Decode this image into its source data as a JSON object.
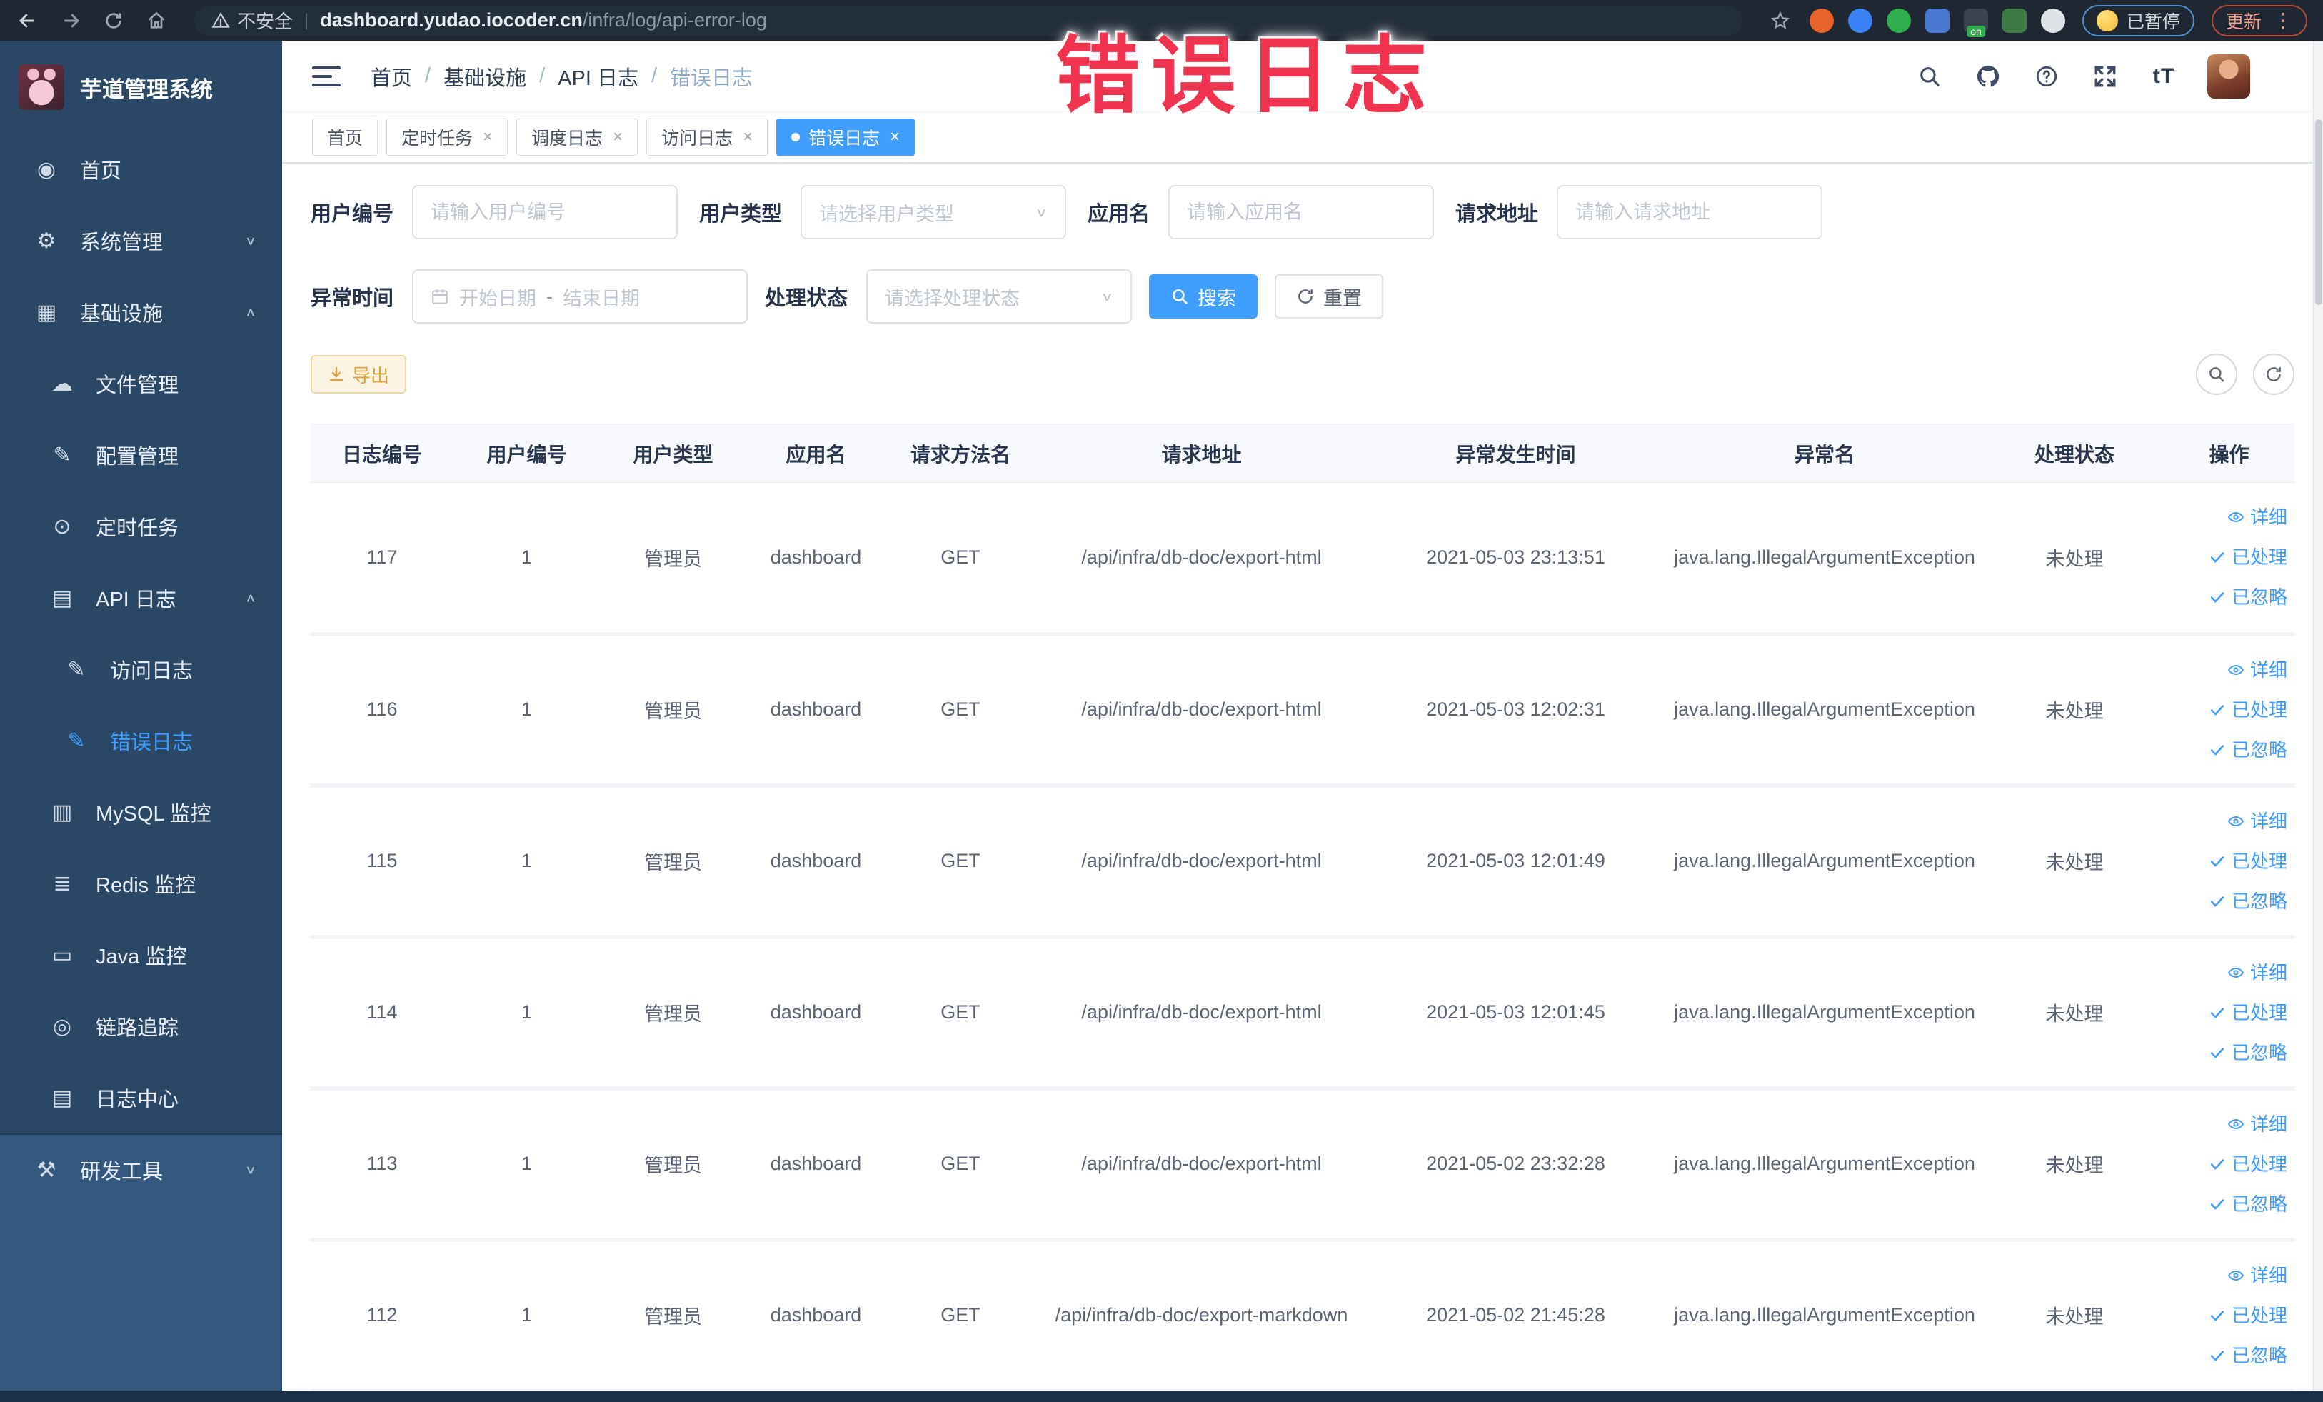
{
  "colors": {
    "accent": "#409eff",
    "sidebar_bg": "#2a4766",
    "sidebar_section_bg": "#35597e",
    "annotation_pink": "#f0344f",
    "export_warning": "#e6a23c",
    "link_blue": "#3d9bff",
    "browser_bar_bg": "#1e2732"
  },
  "annotation": {
    "text": "错误日志"
  },
  "browser": {
    "security_label": "不安全",
    "url_host": "dashboard.yudao.iocoder.cn",
    "url_path": "/infra/log/api-error-log",
    "paused_badge": "已暂停",
    "update_button": "更新",
    "extensions": [
      {
        "name": "orange-ring-extension",
        "color": "#e8622c",
        "shape": "round"
      },
      {
        "name": "blue-pin-extension",
        "color": "#3b82f6",
        "shape": "round"
      },
      {
        "name": "green-check-extension",
        "color": "#2fae4e",
        "shape": "round"
      },
      {
        "name": "blue-grid-extension",
        "color": "#4878d0",
        "shape": "square"
      },
      {
        "name": "switch-on-extension",
        "color": "#3a434e",
        "shape": "square",
        "badge": "on"
      },
      {
        "name": "green-leaf-extension",
        "color": "#3d7a44",
        "shape": "square"
      },
      {
        "name": "white-paw-extension",
        "color": "#dfe3e8",
        "shape": "round"
      }
    ]
  },
  "sidebar": {
    "title": "芋道管理系统",
    "items": [
      {
        "label": "首页",
        "icon": "dashboard",
        "level": 0
      },
      {
        "label": "系统管理",
        "icon": "gear",
        "level": 0,
        "chevron": "down"
      },
      {
        "label": "基础设施",
        "icon": "infrastructure",
        "level": 0,
        "chevron": "up"
      },
      {
        "label": "文件管理",
        "icon": "cloud-upload",
        "level": 1
      },
      {
        "label": "配置管理",
        "icon": "edit",
        "level": 1
      },
      {
        "label": "定时任务",
        "icon": "timer",
        "level": 1
      },
      {
        "label": "API 日志",
        "icon": "log",
        "level": 1,
        "chevron": "up"
      },
      {
        "label": "访问日志",
        "icon": "edit-square",
        "level": 2
      },
      {
        "label": "错误日志",
        "icon": "edit-square",
        "level": 2,
        "active": true
      },
      {
        "label": "MySQL 监控",
        "icon": "mysql",
        "level": 1
      },
      {
        "label": "Redis 监控",
        "icon": "redis",
        "level": 1
      },
      {
        "label": "Java 监控",
        "icon": "java",
        "level": 1
      },
      {
        "label": "链路追踪",
        "icon": "trace",
        "level": 1
      },
      {
        "label": "日志中心",
        "icon": "log-center",
        "level": 1
      },
      {
        "label": "研发工具",
        "icon": "tools",
        "level": 0,
        "chevron": "down",
        "section": true
      }
    ]
  },
  "breadcrumb": {
    "items": [
      {
        "label": "首页"
      },
      {
        "label": "基础设施"
      },
      {
        "label": "API 日志"
      },
      {
        "label": "错误日志",
        "current": true
      }
    ]
  },
  "tabs": {
    "items": [
      {
        "label": "首页"
      },
      {
        "label": "定时任务",
        "closable": true
      },
      {
        "label": "调度日志",
        "closable": true
      },
      {
        "label": "访问日志",
        "closable": true
      },
      {
        "label": "错误日志",
        "closable": true,
        "active": true
      }
    ]
  },
  "filters": {
    "user_id": {
      "label": "用户编号",
      "placeholder": "请输入用户编号"
    },
    "user_type": {
      "label": "用户类型",
      "placeholder": "请选择用户类型"
    },
    "app_name": {
      "label": "应用名",
      "placeholder": "请输入应用名"
    },
    "request_url": {
      "label": "请求地址",
      "placeholder": "请输入请求地址"
    },
    "exception_time": {
      "label": "异常时间",
      "start_placeholder": "开始日期",
      "separator": "-",
      "end_placeholder": "结束日期"
    },
    "process_status": {
      "label": "处理状态",
      "placeholder": "请选择处理状态"
    },
    "search_label": "搜索",
    "reset_label": "重置"
  },
  "toolbar": {
    "export_label": "导出"
  },
  "table": {
    "columns": [
      "日志编号",
      "用户编号",
      "用户类型",
      "应用名",
      "请求方法名",
      "请求地址",
      "异常发生时间",
      "异常名",
      "处理状态",
      "操作"
    ],
    "action_labels": [
      "详细",
      "已处理",
      "已忽略"
    ],
    "rows": [
      {
        "cells": [
          "117",
          "1",
          "管理员",
          "dashboard",
          "GET",
          "/api/infra/db-doc/export-html",
          "2021-05-03 23:13:51",
          "java.lang.IllegalArgumentException",
          "未处理"
        ]
      },
      {
        "cells": [
          "116",
          "1",
          "管理员",
          "dashboard",
          "GET",
          "/api/infra/db-doc/export-html",
          "2021-05-03 12:02:31",
          "java.lang.IllegalArgumentException",
          "未处理"
        ]
      },
      {
        "cells": [
          "115",
          "1",
          "管理员",
          "dashboard",
          "GET",
          "/api/infra/db-doc/export-html",
          "2021-05-03 12:01:49",
          "java.lang.IllegalArgumentException",
          "未处理"
        ]
      },
      {
        "cells": [
          "114",
          "1",
          "管理员",
          "dashboard",
          "GET",
          "/api/infra/db-doc/export-html",
          "2021-05-03 12:01:45",
          "java.lang.IllegalArgumentException",
          "未处理"
        ]
      },
      {
        "cells": [
          "113",
          "1",
          "管理员",
          "dashboard",
          "GET",
          "/api/infra/db-doc/export-html",
          "2021-05-02 23:32:28",
          "java.lang.IllegalArgumentException",
          "未处理"
        ]
      },
      {
        "cells": [
          "112",
          "1",
          "管理员",
          "dashboard",
          "GET",
          "/api/infra/db-doc/export-markdown",
          "2021-05-02 21:45:28",
          "java.lang.IllegalArgumentException",
          "未处理"
        ]
      }
    ]
  }
}
